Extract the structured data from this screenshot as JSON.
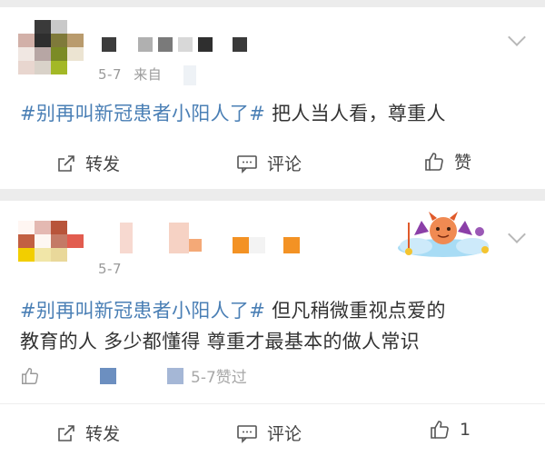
{
  "post1": {
    "date": "5-7",
    "source_prefix": "来自",
    "hashtag": "#别再叫新冠患者小阳人了#",
    "body": " 把人当人看，尊重人",
    "actions": {
      "repost": "转发",
      "comment": "评论",
      "like": "赞"
    }
  },
  "post2": {
    "date": "5-7",
    "hashtag": "#别再叫新冠患者小阳人了#",
    "body_line1": " 但凡稍微重视点爱的",
    "body_line2": "教育的人 多少都懂得 尊重才最基本的做人常识",
    "liked_info": "5-7赞过",
    "actions": {
      "repost": "转发",
      "comment": "评论",
      "like_count": "1"
    }
  },
  "colors": {
    "hashtag": "#4a7fb5",
    "text": "#333333",
    "meta": "#9a9a9a",
    "separator": "#ececec"
  },
  "icons": [
    "repost-icon",
    "comment-icon",
    "thumb-up-icon",
    "chevron-down-icon",
    "devil-sticker"
  ]
}
